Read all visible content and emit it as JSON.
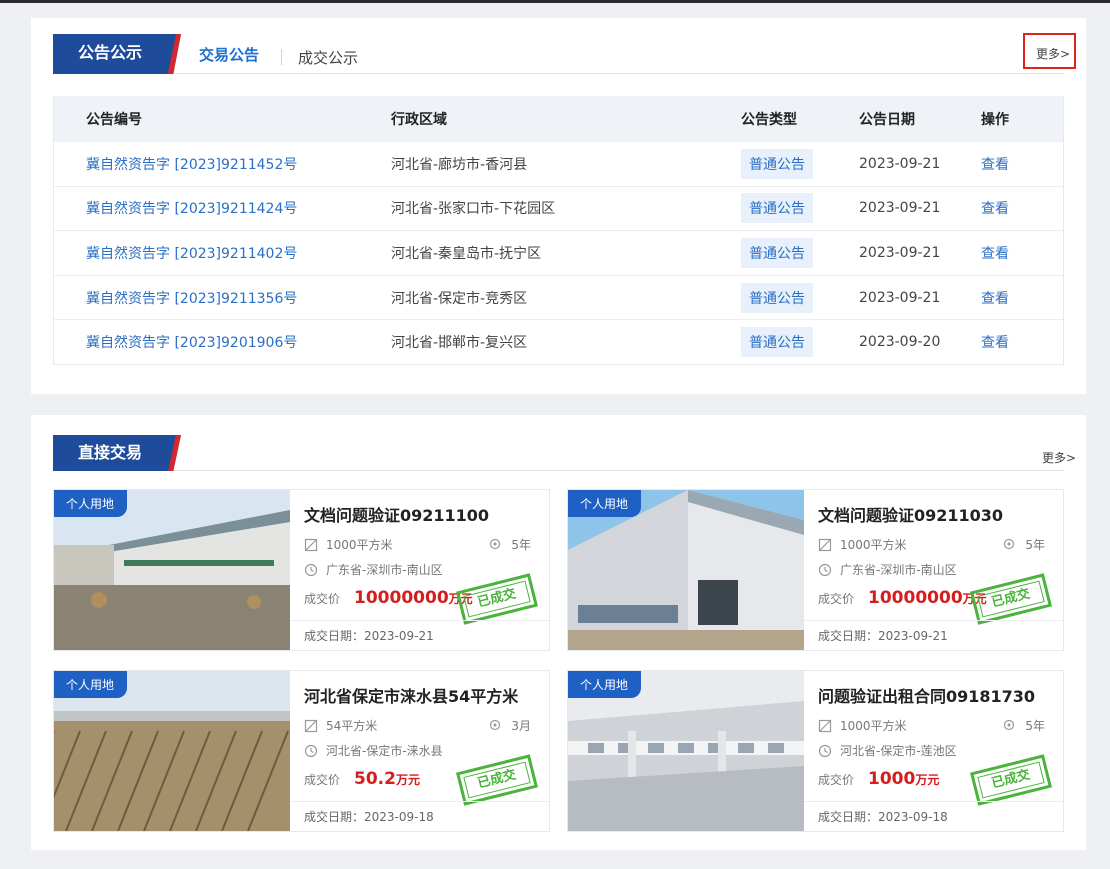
{
  "announcements": {
    "section_title": "公告公示",
    "tabs": [
      "交易公告",
      "成交公示"
    ],
    "more": "更多>",
    "columns": [
      "公告编号",
      "行政区域",
      "公告类型",
      "公告日期",
      "操作"
    ],
    "rows": [
      {
        "id": "冀自然资告字 [2023]9211452号",
        "region": "河北省-廊坊市-香河县",
        "type": "普通公告",
        "date": "2023-09-21",
        "action": "查看"
      },
      {
        "id": "冀自然资告字 [2023]9211424号",
        "region": "河北省-张家口市-下花园区",
        "type": "普通公告",
        "date": "2023-09-21",
        "action": "查看"
      },
      {
        "id": "冀自然资告字 [2023]9211402号",
        "region": "河北省-秦皇岛市-抚宁区",
        "type": "普通公告",
        "date": "2023-09-21",
        "action": "查看"
      },
      {
        "id": "冀自然资告字 [2023]9211356号",
        "region": "河北省-保定市-竞秀区",
        "type": "普通公告",
        "date": "2023-09-21",
        "action": "查看"
      },
      {
        "id": "冀自然资告字 [2023]9201906号",
        "region": "河北省-邯郸市-复兴区",
        "type": "普通公告",
        "date": "2023-09-20",
        "action": "查看"
      }
    ]
  },
  "direct": {
    "section_title": "直接交易",
    "more": "更多>",
    "price_label": "成交价",
    "unit": "万元",
    "stamp": "已成交",
    "cards": [
      {
        "tag": "个人用地",
        "title": "文档问题验证09211100",
        "area": "1000平方米",
        "term": "5年",
        "location": "广东省-深圳市-南山区",
        "price": "10000000",
        "deal_date": "成交日期：2023-09-21"
      },
      {
        "tag": "个人用地",
        "title": "文档问题验证09211030",
        "area": "1000平方米",
        "term": "5年",
        "location": "广东省-深圳市-南山区",
        "price": "10000000",
        "deal_date": "成交日期：2023-09-21"
      },
      {
        "tag": "个人用地",
        "title": "河北省保定市涞水县54平方米",
        "area": "54平方米",
        "term": "3月",
        "location": "河北省-保定市-涞水县",
        "price": "50.2",
        "deal_date": "成交日期：2023-09-18"
      },
      {
        "tag": "个人用地",
        "title": "问题验证出租合同09181730",
        "area": "1000平方米",
        "term": "5年",
        "location": "河北省-保定市-莲池区",
        "price": "1000",
        "deal_date": "成交日期：2023-09-18"
      }
    ]
  }
}
